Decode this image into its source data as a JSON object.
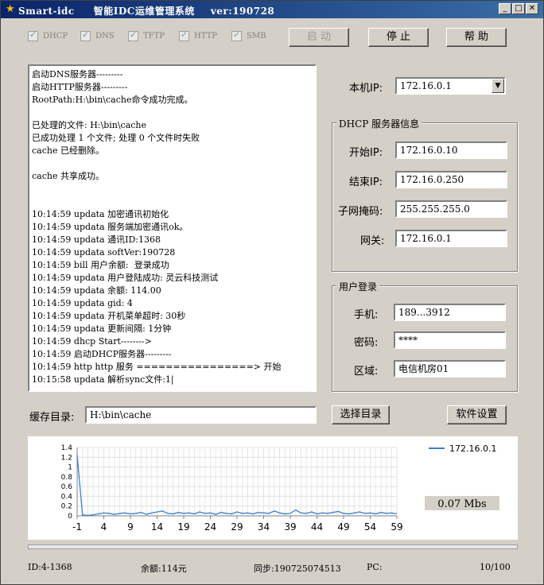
{
  "titlebar": {
    "app_name": "Smart-idc",
    "title": "智能IDC运维管理系统",
    "version": "ver:190728",
    "minimize": "_",
    "maximize": "□",
    "close": "✕"
  },
  "services": [
    {
      "label": "DHCP",
      "checked": true
    },
    {
      "label": "DNS",
      "checked": true
    },
    {
      "label": "TFTP",
      "checked": true
    },
    {
      "label": "HTTP",
      "checked": true
    },
    {
      "label": "SMB",
      "checked": true
    }
  ],
  "toolbar": {
    "start_label": "启 动",
    "stop_label": "停 止",
    "help_label": "帮 助"
  },
  "log": {
    "lines": [
      "启动DNS服务器---------",
      "启动HTTP服务器---------",
      "RootPath:H:\\bin\\cache命令成功完成。",
      "",
      "已处理的文件: H:\\bin\\cache",
      "已成功处理 1 个文件; 处理 0 个文件时失败",
      "cache 已经删除。",
      "",
      "cache 共享成功。",
      "",
      "",
      "10:14:59 updata 加密通讯初始化",
      "10:14:59 updata 服务端加密通讯ok。",
      "10:14:59 updata 通讯ID:1368",
      "10:14:59 updata softVer:190728",
      "10:14:59 bill 用户余额:  登录成功",
      "10:14:59 updata 用户登陆成功: 灵云科技测试",
      "10:14:59 updata 余额: 114.00",
      "10:14:59 updata gid: 4",
      "10:14:59 updata 开机菜单超时: 30秒",
      "10:14:59 updata 更新间隔: 1分钟",
      "10:14:59 dhcp Start-------->",
      "10:14:59 启动DHCP服务器---------",
      "10:14:59 http http 服务 ================> 开始",
      "10:15:58 updata 解析sync文件:1|"
    ]
  },
  "local_ip": {
    "label": "本机IP:",
    "value": "172.16.0.1"
  },
  "dhcp": {
    "group_title": "DHCP 服务器信息",
    "start_ip_label": "开始IP:",
    "start_ip": "172.16.0.10",
    "end_ip_label": "结束IP:",
    "end_ip": "172.16.0.250",
    "subnet_label": "子网掩码:",
    "subnet": "255.255.255.0",
    "gateway_label": "网关:",
    "gateway": "172.16.0.1"
  },
  "user_login": {
    "group_title": "用户登录",
    "phone_label": "手机:",
    "phone": "189...3912",
    "password_label": "密码:",
    "password": "****",
    "region_label": "区域:",
    "region": "电信机房01"
  },
  "cache": {
    "label": "缓存目录:",
    "path": "H:\\bin\\cache",
    "select_label": "选择目录",
    "settings_label": "软件设置"
  },
  "chart_data": {
    "type": "line",
    "x": [
      -1,
      0,
      1,
      2,
      3,
      4,
      5,
      6,
      7,
      8,
      9,
      10,
      11,
      12,
      13,
      14,
      15,
      16,
      17,
      18,
      19,
      20,
      21,
      22,
      23,
      24,
      25,
      26,
      27,
      28,
      29,
      30,
      31,
      32,
      33,
      34,
      35,
      36,
      37,
      38,
      39,
      40,
      41,
      42,
      43,
      44,
      45,
      46,
      47,
      48,
      49,
      50,
      51,
      52,
      53,
      54,
      55,
      56,
      57,
      58,
      59
    ],
    "series": [
      {
        "name": "172.16.0.1",
        "color": "#3c7fd0",
        "values": [
          1.25,
          0.02,
          0.01,
          0.02,
          0.04,
          0.06,
          0.05,
          0.03,
          0.05,
          0.06,
          0.04,
          0.05,
          0.07,
          0.03,
          0.06,
          0.08,
          0.1,
          0.05,
          0.04,
          0.07,
          0.05,
          0.06,
          0.04,
          0.08,
          0.05,
          0.06,
          0.03,
          0.07,
          0.05,
          0.04,
          0.08,
          0.05,
          0.06,
          0.04,
          0.07,
          0.06,
          0.05,
          0.1,
          0.06,
          0.04,
          0.05,
          0.12,
          0.06,
          0.05,
          0.08,
          0.04,
          0.06,
          0.05,
          0.07,
          0.09,
          0.05,
          0.04,
          0.06,
          0.08,
          0.05,
          0.06,
          0.04,
          0.07,
          0.05,
          0.06,
          0.04
        ]
      }
    ],
    "x_ticks": [
      -1,
      4,
      9,
      14,
      19,
      24,
      29,
      34,
      39,
      44,
      49,
      54,
      59
    ],
    "y_ticks": [
      0,
      0.2,
      0.4,
      0.6,
      0.8,
      1.0,
      1.2,
      1.4
    ],
    "y_tick_labels": [
      "0",
      "0.2",
      "0.4",
      "0.6",
      "0.8",
      "1",
      "1.2",
      "1.4"
    ],
    "ylim": [
      0,
      1.4
    ],
    "xlim": [
      -1,
      59
    ],
    "grid": true,
    "legend_placement": "top-right",
    "speed_readout": "0.07 Mbs"
  },
  "status": {
    "id": "ID:4-1368",
    "balance": "余额:114元",
    "sync": "同步:190725074513",
    "pc": "PC:",
    "count": "10/100"
  }
}
